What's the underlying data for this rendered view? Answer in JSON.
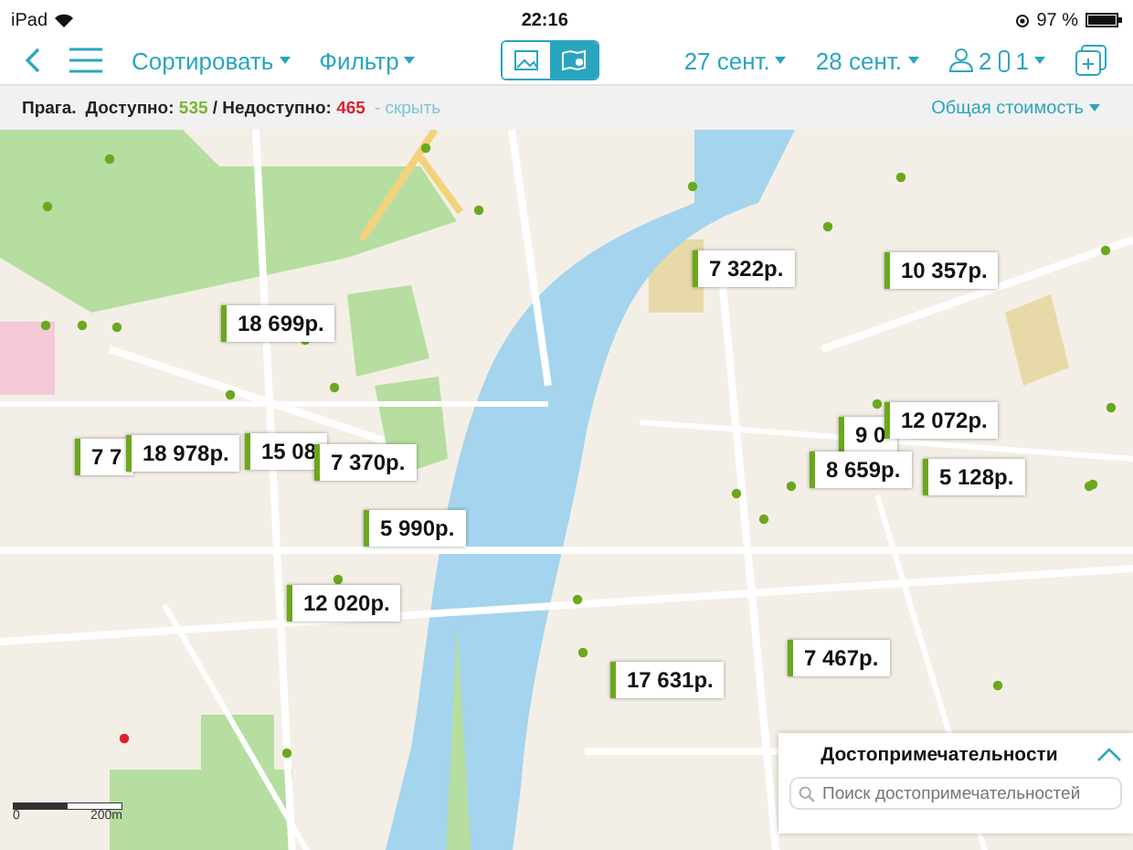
{
  "status_bar": {
    "carrier": "iPad",
    "time": "22:16",
    "battery": "97 %"
  },
  "toolbar": {
    "sort": "Сортировать",
    "filter": "Фильтр",
    "view_tabs": [
      {
        "kind": "photos",
        "selected": false
      },
      {
        "kind": "map",
        "selected": true
      }
    ],
    "check_in": "27 сент.",
    "check_out": "28 сент.",
    "guests": "2",
    "rooms": "1"
  },
  "info_bar": {
    "city": "Прага.",
    "available_label": "Доступно:",
    "available": "535",
    "unavailable_label": "/ Недоступно:",
    "unavailable": "465",
    "hide_link": "- скрыть",
    "sort_by": "Общая стоимость"
  },
  "map": {
    "scale_start": "0",
    "scale_end": "200m",
    "price_markers": [
      {
        "price": "18 699р."
      },
      {
        "price": "7 322р."
      },
      {
        "price": "10 357р."
      },
      {
        "price": "7 7"
      },
      {
        "price": "18 978р."
      },
      {
        "price": "15 08"
      },
      {
        "price": "7 370р."
      },
      {
        "price": "5 990р."
      },
      {
        "price": "9 0"
      },
      {
        "price": "12 072р."
      },
      {
        "price": "5 128р."
      },
      {
        "price": "8 659р."
      },
      {
        "price": "12 020р."
      },
      {
        "price": "17 631р."
      },
      {
        "price": "7 467р."
      }
    ]
  },
  "attractions_panel": {
    "title": "Достопримечательности",
    "search_placeholder": "Поиск достопримечательностей"
  }
}
